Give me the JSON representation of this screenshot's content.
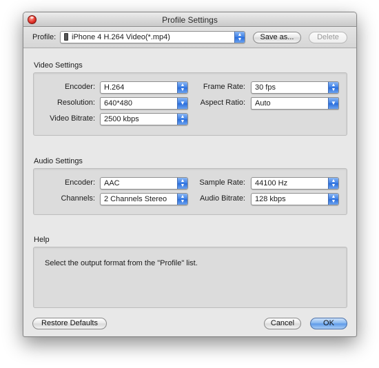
{
  "window": {
    "title": "Profile Settings"
  },
  "profile": {
    "label": "Profile:",
    "value": "iPhone 4 H.264 Video(*.mp4)",
    "icon": "iphone-icon",
    "save_as_label": "Save as...",
    "delete_label": "Delete"
  },
  "video": {
    "section_title": "Video Settings",
    "encoder_label": "Encoder:",
    "encoder_value": "H.264",
    "frame_rate_label": "Frame Rate:",
    "frame_rate_value": "30 fps",
    "resolution_label": "Resolution:",
    "resolution_value": "640*480",
    "aspect_ratio_label": "Aspect Ratio:",
    "aspect_ratio_value": "Auto",
    "bitrate_label": "Video Bitrate:",
    "bitrate_value": "2500 kbps"
  },
  "audio": {
    "section_title": "Audio Settings",
    "encoder_label": "Encoder:",
    "encoder_value": "AAC",
    "sample_rate_label": "Sample Rate:",
    "sample_rate_value": "44100 Hz",
    "channels_label": "Channels:",
    "channels_value": "2 Channels Stereo",
    "bitrate_label": "Audio Bitrate:",
    "bitrate_value": "128 kbps"
  },
  "help": {
    "section_title": "Help",
    "text": "Select the output format from the \"Profile\" list."
  },
  "footer": {
    "restore_label": "Restore Defaults",
    "cancel_label": "Cancel",
    "ok_label": "OK"
  },
  "colors": {
    "accent": "#3b7ee6",
    "close": "#e3322a"
  }
}
